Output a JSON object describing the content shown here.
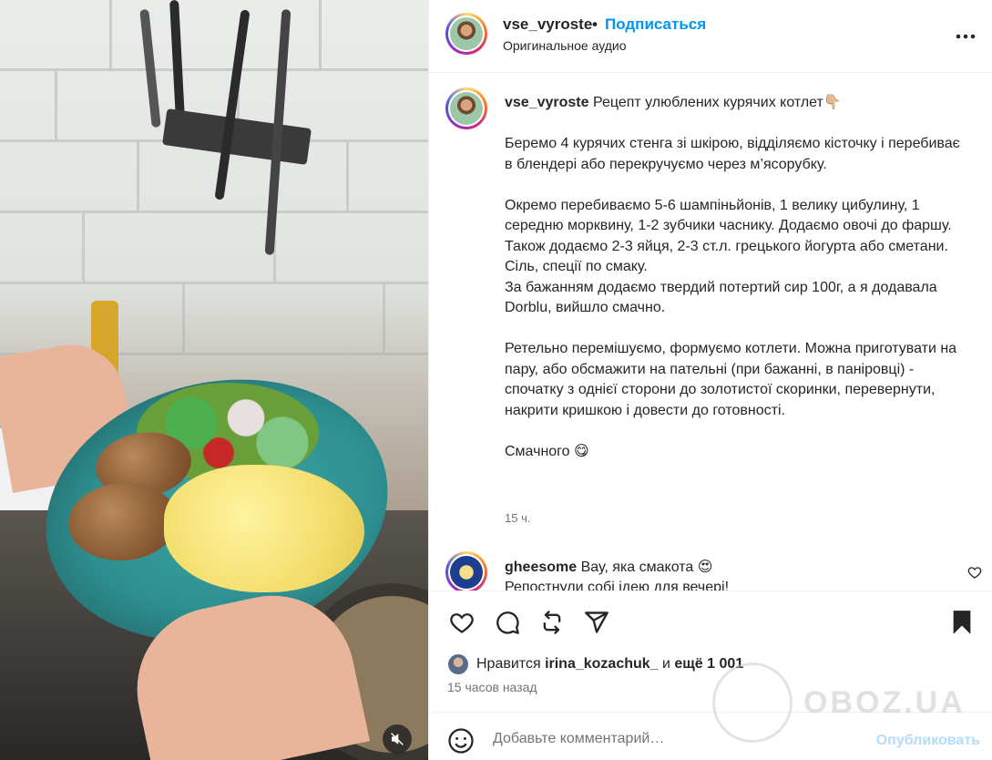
{
  "post": {
    "username": "vse_vyroste",
    "separator": "•",
    "follow_label": "Подписаться",
    "audio_label": "Оригинальное аудио",
    "caption": "Рецепт улюблених курячих котлет👇🏼\n\nБеремо 4 курячих стенга зі шкірою, відділяємо кісточку і перебиває в блендері або перекручуємо через м’ясорубку.\n\nОкремо перебиваємо 5-6 шампіньйонів, 1 велику цибулину, 1 середню морквину, 1-2 зубчики часнику. Додаємо овочі до фаршу.\nТакож додаємо 2-3 яйця, 2-3 ст.л. грецького йогурта або сметани. Сіль, спеції по смаку.\nЗа бажанням додаємо твердий потертий сир 100г, а я додавала Dorblu, вийшло смачно.\n\nРетельно перемішуємо, формуємо котлети. Можна приготувати на пару, або обсмажити на пательні (при бажанні, в паніровці) - спочатку з однієї сторони до золотистої скоринки, перевернути, накрити кришкою і довести до готовності.\n\nСмачного 😋",
    "time_ago": "15 ч."
  },
  "comment": {
    "username": "gheesome",
    "text": "Вау, яка смакота 😍\nРепостнули собі ідею для вечері!"
  },
  "likes": {
    "prefix": "Нравится",
    "user": "irina_kozachuk_",
    "conj": "и",
    "others": "ещё 1 001"
  },
  "posted_ago": "15 часов назад",
  "add_comment": {
    "placeholder": "Добавьте комментарий…",
    "publish_label": "Опубликовать"
  },
  "watermark": "OBOZ.UA",
  "colors": {
    "accent": "#0095f6",
    "publish_disabled": "#b3dbff",
    "text": "#262626",
    "secondary": "#737373"
  },
  "icons": [
    "more-icon",
    "heart-icon",
    "comment-icon",
    "repost-icon",
    "share-icon",
    "bookmark-icon",
    "emoji-icon",
    "mute-icon"
  ]
}
